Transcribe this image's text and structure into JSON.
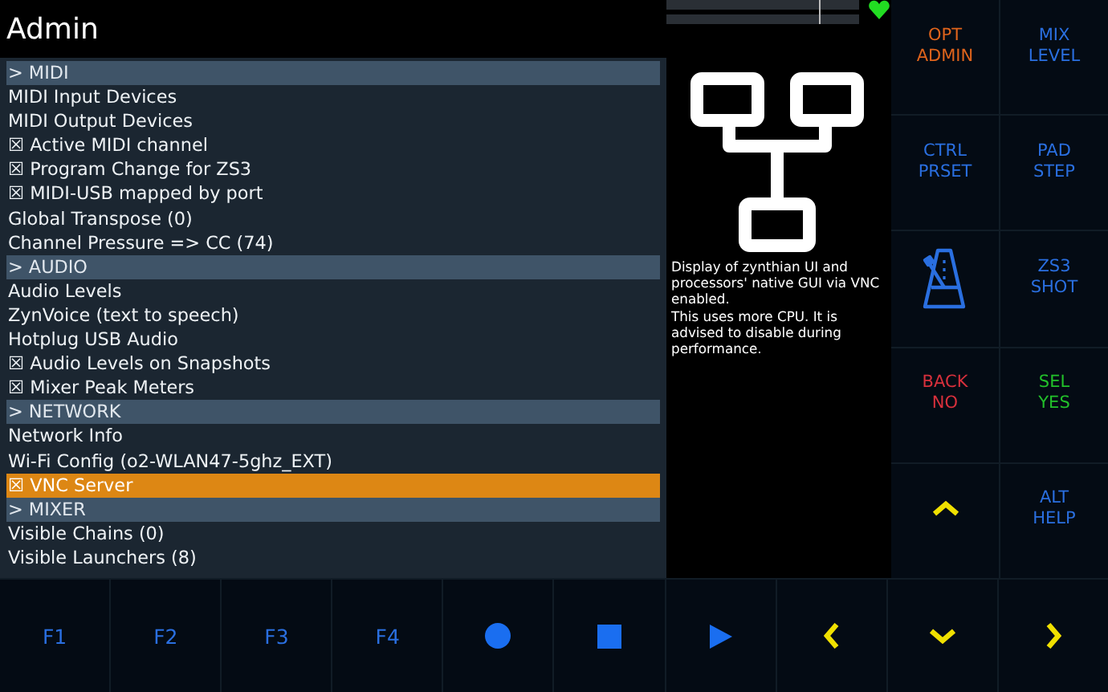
{
  "title": "Admin",
  "menu": [
    {
      "kind": "header",
      "label": "> MIDI",
      "selected": false
    },
    {
      "kind": "item",
      "label": "MIDI Input Devices",
      "selected": false
    },
    {
      "kind": "item",
      "label": "MIDI Output Devices",
      "selected": false
    },
    {
      "kind": "item",
      "label": "☒ Active MIDI channel",
      "selected": false
    },
    {
      "kind": "item",
      "label": "☒ Program Change for ZS3",
      "selected": false
    },
    {
      "kind": "item",
      "label": "☒ MIDI-USB mapped by port",
      "selected": false
    },
    {
      "kind": "item",
      "label": "Global Transpose (0)",
      "selected": false
    },
    {
      "kind": "item",
      "label": "Channel Pressure => CC (74)",
      "selected": false
    },
    {
      "kind": "header",
      "label": "> AUDIO",
      "selected": false
    },
    {
      "kind": "item",
      "label": "Audio Levels",
      "selected": false
    },
    {
      "kind": "item",
      "label": "ZynVoice (text to speech)",
      "selected": false
    },
    {
      "kind": "item",
      "label": "Hotplug USB Audio",
      "selected": false
    },
    {
      "kind": "item",
      "label": "☒ Audio Levels on Snapshots",
      "selected": false
    },
    {
      "kind": "item",
      "label": "☒ Mixer Peak Meters",
      "selected": false
    },
    {
      "kind": "header",
      "label": "> NETWORK",
      "selected": false
    },
    {
      "kind": "item",
      "label": "Network Info",
      "selected": false
    },
    {
      "kind": "item",
      "label": "Wi-Fi Config (o2-WLAN47-5ghz_EXT)",
      "selected": false
    },
    {
      "kind": "item",
      "label": "☒ VNC Server",
      "selected": true
    },
    {
      "kind": "header",
      "label": "> MIXER",
      "selected": false
    },
    {
      "kind": "item",
      "label": "Visible Chains (0)",
      "selected": false
    },
    {
      "kind": "item",
      "label": "Visible Launchers (8)",
      "selected": false
    }
  ],
  "info": {
    "paragraphs": [
      "Display of zynthian UI and processors' native GUI via VNC enabled.",
      "This uses more CPU. It is advised to disable during performance."
    ]
  },
  "pads": [
    {
      "kind": "text",
      "label": "OPT\nADMIN",
      "color": "#e0641c"
    },
    {
      "kind": "text",
      "label": "MIX\nLEVEL",
      "color": "#2a6fe0"
    },
    {
      "kind": "text",
      "label": "CTRL\nPRSET",
      "color": "#2a6fe0"
    },
    {
      "kind": "text",
      "label": "PAD\nSTEP",
      "color": "#2a6fe0"
    },
    {
      "kind": "metronome",
      "color": "#2a6fe0"
    },
    {
      "kind": "text",
      "label": "ZS3\nSHOT",
      "color": "#2a6fe0"
    },
    {
      "kind": "text",
      "label": "BACK\nNO",
      "color": "#d8303c"
    },
    {
      "kind": "text",
      "label": "SEL\nYES",
      "color": "#22c02a"
    },
    {
      "kind": "up",
      "color": "#f0e000"
    },
    {
      "kind": "text",
      "label": "ALT\nHELP",
      "color": "#2a6fe0"
    }
  ],
  "bottom": [
    {
      "kind": "text",
      "label": "F1",
      "color": "#2a6fe0"
    },
    {
      "kind": "text",
      "label": "F2",
      "color": "#2a6fe0"
    },
    {
      "kind": "text",
      "label": "F3",
      "color": "#2a6fe0"
    },
    {
      "kind": "text",
      "label": "F4",
      "color": "#2a6fe0"
    },
    {
      "kind": "record",
      "color": "#1a6ef0"
    },
    {
      "kind": "stop",
      "color": "#1a6ef0"
    },
    {
      "kind": "play",
      "color": "#1a6ef0"
    },
    {
      "kind": "left",
      "color": "#f0e000"
    },
    {
      "kind": "down",
      "color": "#f0e000"
    },
    {
      "kind": "right",
      "color": "#f0e000"
    }
  ]
}
